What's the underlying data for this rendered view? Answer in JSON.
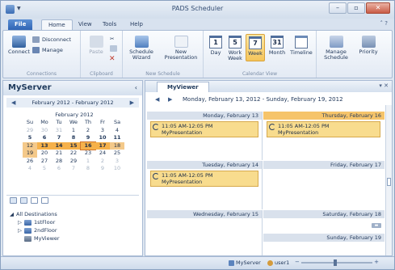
{
  "window": {
    "title": "PADS Scheduler"
  },
  "tabs": {
    "file": "File",
    "home": "Home",
    "view": "View",
    "tools": "Tools",
    "help": "Help"
  },
  "ribbon": {
    "connections": {
      "label": "Connections",
      "connect": "Connect",
      "disconnect": "Disconnect",
      "manage": "Manage"
    },
    "clipboard": {
      "label": "Clipboard",
      "paste": "Paste"
    },
    "new_schedule": {
      "label": "New Schedule",
      "wizard": "Schedule Wizard",
      "new_presentation": "New Presentation"
    },
    "calendar_view": {
      "label": "Calendar View",
      "day": "Day",
      "work_week": "Work Week",
      "week": "Week",
      "month": "Month",
      "timeline": "Timeline",
      "day_num": "1",
      "work_week_num": "5",
      "week_num": "7",
      "month_num": "31"
    },
    "manage_schedule": "Manage Schedule",
    "priority": "Priority"
  },
  "left_panel": {
    "server": "MyServer",
    "range": "February 2012 - February 2012",
    "mini_calendar": {
      "title": "February 2012",
      "dow": [
        "Su",
        "Mo",
        "Tu",
        "We",
        "Th",
        "Fr",
        "Sa"
      ],
      "weeks": [
        [
          "29",
          "30",
          "31",
          "1",
          "2",
          "3",
          "4"
        ],
        [
          "5",
          "6",
          "7",
          "8",
          "9",
          "10",
          "11"
        ],
        [
          "12",
          "13",
          "14",
          "15",
          "16",
          "17",
          "18"
        ],
        [
          "19",
          "20",
          "21",
          "22",
          "23",
          "24",
          "25"
        ],
        [
          "26",
          "27",
          "28",
          "29",
          "1",
          "2",
          "3"
        ],
        [
          "4",
          "5",
          "6",
          "7",
          "8",
          "9",
          "10"
        ]
      ]
    },
    "tree": {
      "root": "All Destinations",
      "items": [
        "1stFloor",
        "2ndFloor",
        "MyViewer"
      ]
    }
  },
  "right_panel": {
    "doc_tab": "MyViewer",
    "date_range": "Monday, February 13, 2012 - Sunday, February 19, 2012",
    "days": {
      "mon": "Monday, February 13",
      "thu": "Thursday, February 16",
      "tue": "Tuesday, February 14",
      "fri": "Friday, February 17",
      "wed": "Wednesday, February 15",
      "sat": "Saturday, February 18",
      "sun": "Sunday, February 19"
    },
    "appointments": {
      "mon": {
        "time": "11:05 AM-12:05 PM",
        "name": "MyPresentation"
      },
      "thu": {
        "time": "11:05 AM-12:05 PM",
        "name": "MyPresentation"
      },
      "tue": {
        "time": "11:05 AM-12:05 PM",
        "name": "MyPresentation"
      }
    }
  },
  "status": {
    "server": "MyServer",
    "user": "user1"
  },
  "colors": {
    "accent": "#f6c46a",
    "appointment": "#f8dc8e",
    "file_tab": "#2f64b4"
  }
}
